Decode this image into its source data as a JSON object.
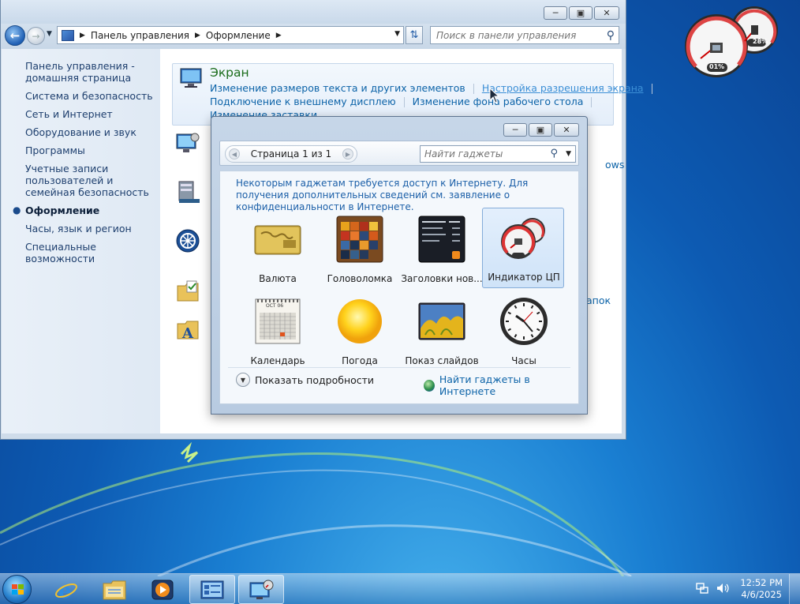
{
  "desktop": {
    "meter": {
      "cpu_percent": "01%",
      "memory_percent": "28%"
    }
  },
  "control_panel": {
    "breadcrumb": [
      "Панель управления",
      "Оформление"
    ],
    "search_placeholder": "Поиск в панели управления",
    "nav": [
      {
        "label": "Панель управления - домашняя страница",
        "current": false
      },
      {
        "label": "Система и безопасность",
        "current": false
      },
      {
        "label": "Сеть и Интернет",
        "current": false
      },
      {
        "label": "Оборудование и звук",
        "current": false
      },
      {
        "label": "Программы",
        "current": false
      },
      {
        "label": "Учетные записи пользователей и семейная безопасность",
        "current": false
      },
      {
        "label": "Оформление",
        "current": true
      },
      {
        "label": "Часы, язык и регион",
        "current": false
      },
      {
        "label": "Специальные возможности",
        "current": false
      }
    ],
    "display_category": {
      "title": "Экран",
      "links": [
        "Изменение размеров текста и других элементов",
        "Настройка разрешения экрана",
        "Подключение к внешнему дисплею",
        "Изменение фона рабочего стола",
        "Изменение заставки"
      ]
    },
    "partial_texts": {
      "windows": "ows",
      "folders": "апок"
    }
  },
  "gadget_gallery": {
    "page_label": "Страница 1 из 1",
    "search_placeholder": "Найти гаджеты",
    "notice": "Некоторым гаджетам требуется доступ к Интернету. Для получения дополнительных сведений см. заявление о конфиденциальности в Интернете.",
    "gadgets": [
      {
        "name": "Валюта",
        "icon": "currency-gadget-icon",
        "selected": false
      },
      {
        "name": "Головоломка",
        "icon": "puzzle-gadget-icon",
        "selected": false
      },
      {
        "name": "Заголовки нов...",
        "icon": "news-headlines-gadget-icon",
        "selected": false
      },
      {
        "name": "Индикатор ЦП",
        "icon": "cpu-meter-gadget-icon",
        "selected": true
      },
      {
        "name": "Календарь",
        "icon": "calendar-gadget-icon",
        "selected": false
      },
      {
        "name": "Погода",
        "icon": "weather-gadget-icon",
        "selected": false
      },
      {
        "name": "Показ слайдов",
        "icon": "slideshow-gadget-icon",
        "selected": false
      },
      {
        "name": "Часы",
        "icon": "clock-gadget-icon",
        "selected": false
      }
    ],
    "calendar_month": "ОСТ 06",
    "show_details": "Показать подробности",
    "get_online": "Найти гаджеты в Интернете"
  },
  "taskbar": {
    "pinned": [
      "start-button",
      "internet-explorer",
      "windows-explorer",
      "media-player",
      "control-panel",
      "gadget-gallery"
    ],
    "clock": {
      "time": "12:52 PM",
      "date": "4/6/2025"
    }
  }
}
